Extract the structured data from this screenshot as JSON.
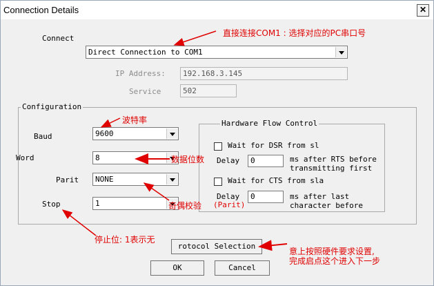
{
  "window": {
    "title": "Connection Details"
  },
  "connect": {
    "label": "Connect",
    "selected": "Direct Connection to COM1",
    "ip_label": "IP Address:",
    "ip_value": "192.168.3.145",
    "service_label": "Service",
    "service_value": "502"
  },
  "configuration": {
    "legend": "Configuration",
    "baud_label": "Baud",
    "baud_value": "9600",
    "word_label": "Word",
    "word_value": "8",
    "parity_label": "Parit",
    "parity_value": "NONE",
    "stop_label": "Stop",
    "stop_value": "1"
  },
  "flow_control": {
    "legend": "Hardware Flow Control",
    "dsr_label": "Wait for DSR from sl",
    "delay1_label": "Delay",
    "delay1_value": "0",
    "delay1_suffix_line1": "ms after RTS before",
    "delay1_suffix_line2": "transmitting first",
    "cts_label": "Wait for CTS from sla",
    "delay2_label": "Delay",
    "delay2_value": "0",
    "delay2_suffix_line1": "ms after last",
    "delay2_suffix_line2": "character before"
  },
  "buttons": {
    "protocol": "rotocol Selection",
    "ok": "OK",
    "cancel": "Cancel"
  },
  "annotations": {
    "connect_note": "直接连接COM1 : 选择对应的PC串口号",
    "baud_note": "波特率",
    "word_note": "数据位数",
    "parity_note_cn": "奇偶校验",
    "parity_note_en": "(Parit)",
    "stop_note": "停止位: 1表示无",
    "protocol_note_line1": "意上按照硬件要求设置,",
    "protocol_note_line2": "完成启点这个进入下一步"
  },
  "colors": {
    "annotation": "#e00000",
    "window_bg": "#f0f0f0"
  }
}
